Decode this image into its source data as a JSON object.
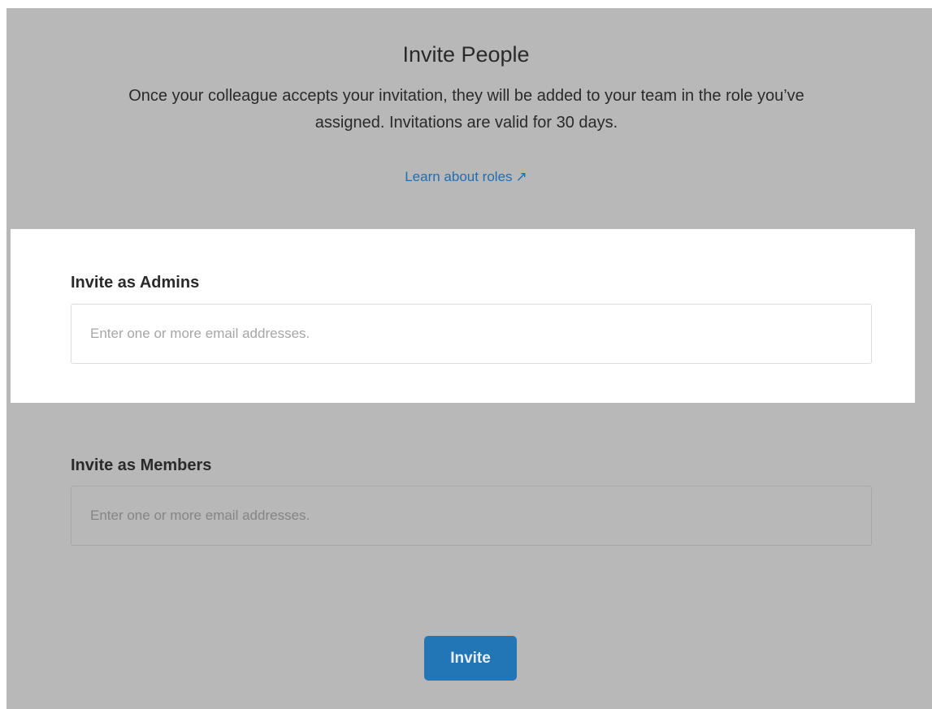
{
  "header": {
    "title": "Invite People",
    "description": "Once your colleague accepts your invitation, they will be added to your team in the role you’ve assigned. Invitations are valid for 30 days.",
    "learn_link": "Learn about roles",
    "learn_link_icon": "external-link-arrow-icon"
  },
  "admins": {
    "label": "Invite as Admins",
    "value": "",
    "placeholder": "Enter one or more email addresses."
  },
  "members": {
    "label": "Invite as Members",
    "value": "",
    "placeholder": "Enter one or more email addresses."
  },
  "actions": {
    "invite_label": "Invite"
  },
  "colors": {
    "overlay": "#b8b8b8",
    "accent": "#2376b6",
    "link": "#1f6eb5"
  }
}
